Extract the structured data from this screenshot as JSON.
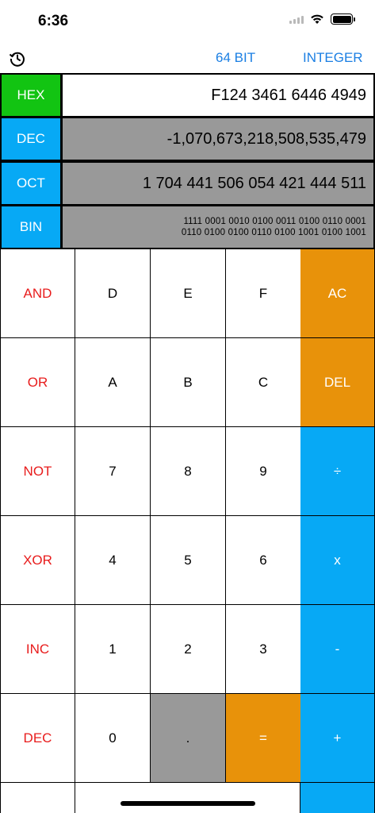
{
  "status": {
    "time": "6:36"
  },
  "toolbar": {
    "bits_label": "64 BIT",
    "mode_label": "INTEGER"
  },
  "display": {
    "rows": [
      {
        "label": "HEX",
        "value": "F124 3461 6446 4949",
        "active": true
      },
      {
        "label": "DEC",
        "value": "-1,070,673,218,508,535,479",
        "active": false
      },
      {
        "label": "OCT",
        "value": "1 704 441 506 054 421 444 511",
        "active": false
      },
      {
        "label": "BIN",
        "value_line1": "1111 0001 0010 0100 0011 0100 0110 0001",
        "value_line2": "0110 0100 0100 0110 0100 1001 0100 1001",
        "active": false
      }
    ]
  },
  "keypad": {
    "rows": [
      [
        "AND",
        "D",
        "E",
        "F",
        "AC"
      ],
      [
        "OR",
        "A",
        "B",
        "C",
        "DEL"
      ],
      [
        "NOT",
        "7",
        "8",
        "9",
        "÷"
      ],
      [
        "XOR",
        "4",
        "5",
        "6",
        "x"
      ],
      [
        "INC",
        "1",
        "2",
        "3",
        "-"
      ],
      [
        "DEC",
        "0",
        ".",
        "=",
        "+"
      ]
    ]
  },
  "colors": {
    "active_label": "#12c412",
    "label": "#07a9f5",
    "value_bg": "#999999",
    "op_text": "#e81c1c",
    "orange": "#e8920a",
    "blue": "#07a9f5",
    "link": "#1b7fe3"
  }
}
